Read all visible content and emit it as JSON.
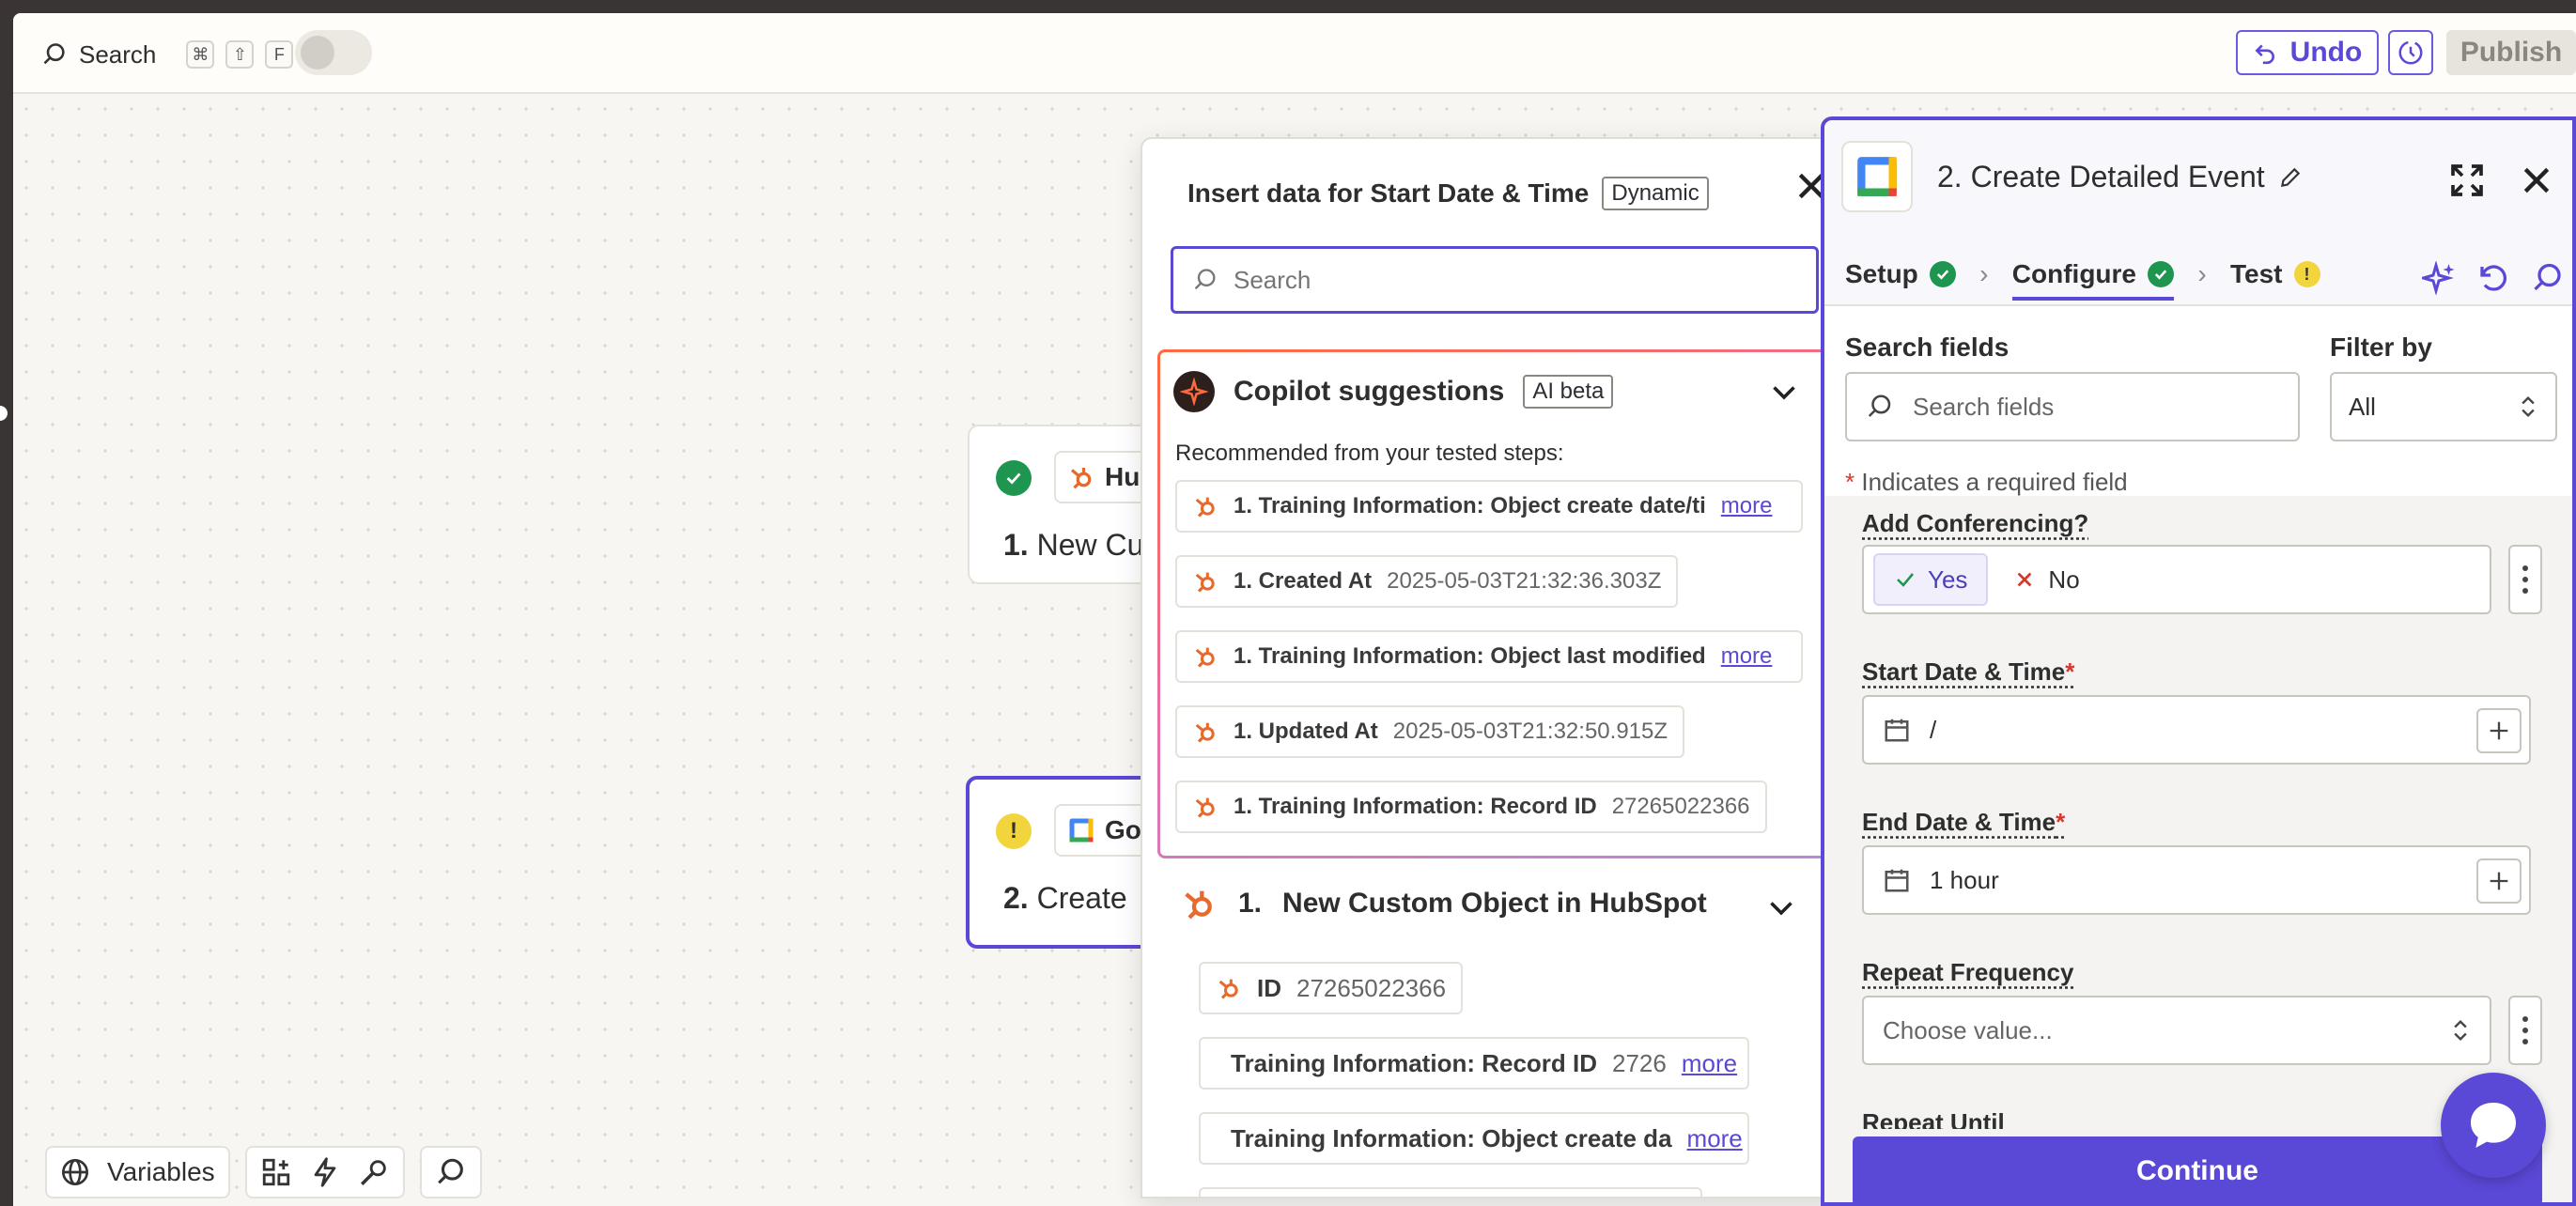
{
  "topbar": {
    "search_label": "Search",
    "shortcut_keys": [
      "⌘",
      "⇧",
      "F"
    ],
    "undo_label": "Undo",
    "publish_label": "Publish"
  },
  "canvas": {
    "node1": {
      "chip_text": "Hu",
      "step": "1.",
      "title": "New Cu"
    },
    "node2": {
      "chip_text": "Go",
      "step": "2.",
      "title": "Create"
    }
  },
  "bottom_tools": {
    "variables_label": "Variables"
  },
  "popover": {
    "title": "Insert data for Start Date & Time",
    "badge": "Dynamic",
    "search_placeholder": "Search",
    "copilot": {
      "title": "Copilot suggestions",
      "badge": "AI beta",
      "subtitle": "Recommended from your tested steps:",
      "suggestions": [
        {
          "label": "1. Training Information: Object create date/ti",
          "value": "",
          "more": "more"
        },
        {
          "label": "1. Created At",
          "value": "2025-05-03T21:32:36.303Z",
          "more": ""
        },
        {
          "label": "1. Training Information: Object last modified",
          "value": "",
          "more": "more"
        },
        {
          "label": "1. Updated At",
          "value": "2025-05-03T21:32:50.915Z",
          "more": ""
        },
        {
          "label": "1. Training Information: Record ID",
          "value": "27265022366",
          "more": ""
        }
      ]
    },
    "step_section": {
      "number": "1.",
      "title": "New Custom Object in HubSpot",
      "items": [
        {
          "label": "ID",
          "value": "27265022366",
          "more": ""
        },
        {
          "label": "Training Information: Record ID",
          "value": "2726",
          "more": "more"
        },
        {
          "label": "Training Information: Object create da",
          "value": "",
          "more": "more"
        }
      ]
    }
  },
  "panel": {
    "title": "2. Create Detailed Event",
    "tabs": [
      {
        "label": "Setup",
        "status": "complete"
      },
      {
        "label": "Configure",
        "status": "complete"
      },
      {
        "label": "Test",
        "status": "warning"
      }
    ],
    "search_fields_label": "Search fields",
    "search_fields_placeholder": "Search fields",
    "filter_label": "Filter by",
    "filter_value": "All",
    "required_note": "Indicates a required field",
    "required_star": "*",
    "fields": {
      "conferencing": {
        "label": "Add Conferencing?",
        "yes": "Yes",
        "no": "No"
      },
      "start": {
        "label": "Start Date & Time",
        "value": "/"
      },
      "end": {
        "label": "End Date & Time",
        "value": "1 hour"
      },
      "repeat": {
        "label": "Repeat Frequency",
        "placeholder": "Choose value..."
      },
      "repeat_until": {
        "label": "Repeat Until"
      }
    },
    "continue_label": "Continue"
  },
  "colors": {
    "accent": "#5a48d6",
    "success": "#1f9650",
    "warning": "#f2d43d",
    "hubspot": "#e8692b",
    "required": "#d6372d"
  }
}
